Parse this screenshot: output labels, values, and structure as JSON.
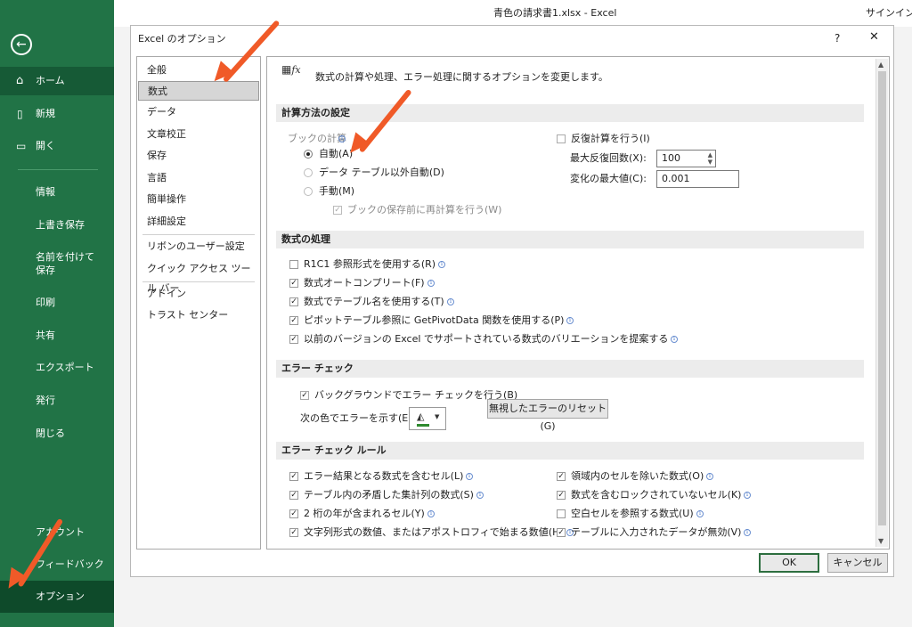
{
  "app": {
    "title": "青色の請求書1.xlsx - Excel",
    "signin": "サインイン"
  },
  "backstage": {
    "back_label": "",
    "items": [
      {
        "label": "ホーム"
      },
      {
        "label": "新規"
      },
      {
        "label": "開く"
      },
      {
        "label": "情報"
      },
      {
        "label": "上書き保存"
      },
      {
        "label": "名前を付けて保存"
      },
      {
        "label": "印刷"
      },
      {
        "label": "共有"
      },
      {
        "label": "エクスポート"
      },
      {
        "label": "発行"
      },
      {
        "label": "閉じる"
      },
      {
        "label": "アカウント"
      },
      {
        "label": "フィードバック"
      },
      {
        "label": "オプション"
      }
    ]
  },
  "dialog": {
    "title": "Excel のオプション",
    "help": "?",
    "close": "✕",
    "nav": [
      {
        "label": "全般"
      },
      {
        "label": "数式"
      },
      {
        "label": "データ"
      },
      {
        "label": "文章校正"
      },
      {
        "label": "保存"
      },
      {
        "label": "言語"
      },
      {
        "label": "簡単操作"
      },
      {
        "label": "詳細設定"
      },
      {
        "label": "リボンのユーザー設定"
      },
      {
        "label": "クイック アクセス ツール バー"
      },
      {
        "label": "アドイン"
      },
      {
        "label": "トラスト センター"
      }
    ],
    "header_text": "数式の計算や処理、エラー処理に関するオプションを変更します。",
    "calc": {
      "heading": "計算方法の設定",
      "workbook_label": "ブックの計算",
      "auto": "自動(A)",
      "auto_except": "データ テーブル以外自動(D)",
      "manual": "手動(M)",
      "recalc_save": "ブックの保存前に再計算を行う(W)",
      "iterative": "反復計算を行う(I)",
      "max_iter_label": "最大反復回数(X):",
      "max_iter_value": "100",
      "max_change_label": "変化の最大値(C):",
      "max_change_value": "0.001"
    },
    "formulas": {
      "heading": "数式の処理",
      "items": [
        {
          "label": "R1C1 参照形式を使用する(R)",
          "checked": false
        },
        {
          "label": "数式オートコンプリート(F)",
          "checked": true
        },
        {
          "label": "数式でテーブル名を使用する(T)",
          "checked": true
        },
        {
          "label": "ピボットテーブル参照に GetPivotData 関数を使用する(P)",
          "checked": true
        },
        {
          "label": "以前のバージョンの Excel でサポートされている数式のバリエーションを提案する",
          "checked": true
        }
      ]
    },
    "error_check": {
      "heading": "エラー チェック",
      "background": "バックグラウンドでエラー チェックを行う(B)",
      "color_label": "次の色でエラーを示す(E):",
      "reset_button": "無視したエラーのリセット(G)"
    },
    "rules": {
      "heading": "エラー チェック ルール",
      "left": [
        {
          "label": "エラー結果となる数式を含むセル(L)",
          "checked": true
        },
        {
          "label": "テーブル内の矛盾した集計列の数式(S)",
          "checked": true
        },
        {
          "label": "2 桁の年が含まれるセル(Y)",
          "checked": true
        },
        {
          "label": "文字列形式の数値、またはアポストロフィで始まる数値(H)",
          "checked": true
        }
      ],
      "right": [
        {
          "label": "領域内のセルを除いた数式(O)",
          "checked": true
        },
        {
          "label": "数式を含むロックされていないセル(K)",
          "checked": true
        },
        {
          "label": "空白セルを参照する数式(U)",
          "checked": false
        },
        {
          "label": "テーブルに入力されたデータが無効(V)",
          "checked": true
        }
      ]
    },
    "ok": "OK",
    "cancel": "キャンセル"
  },
  "colors": {
    "backstage": "#217346",
    "arrow": "#f05a28",
    "error_indicator": "#2e8b2e"
  }
}
